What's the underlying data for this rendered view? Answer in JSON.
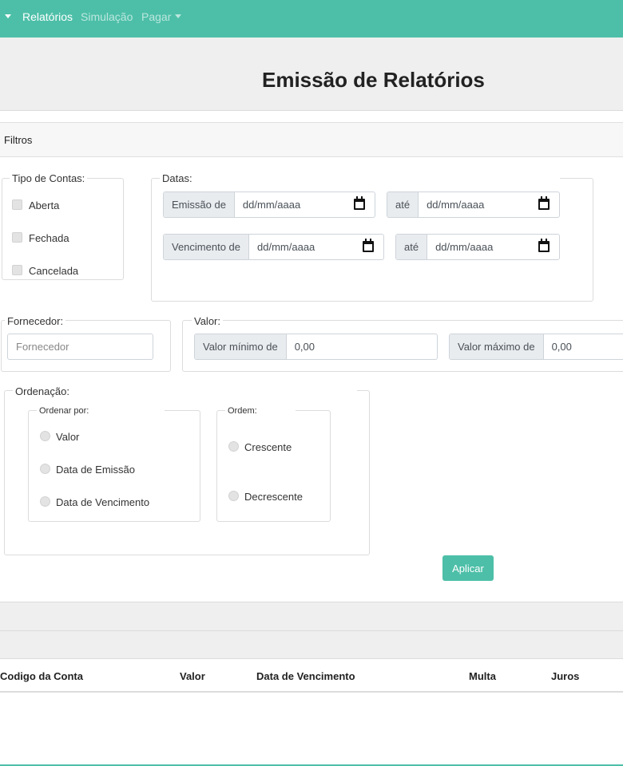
{
  "navbar": {
    "items": [
      {
        "label": "Relatórios",
        "active": true
      },
      {
        "label": "Simulação",
        "active": false
      },
      {
        "label": "Pagar",
        "active": false,
        "dropdown": true
      }
    ],
    "brand_color": "#4dbfa8"
  },
  "header": {
    "title": "Emissão de Relatórios"
  },
  "filters": {
    "title": "Filtros",
    "account_types": {
      "legend": "Tipo de Contas:",
      "options": [
        "Aberta",
        "Fechada",
        "Cancelada"
      ]
    },
    "dates": {
      "legend": "Datas:",
      "emission_label": "Emissão de",
      "due_label": "Vencimento de",
      "until_label": "até",
      "date_placeholder": "dd/mm/aaaa"
    },
    "supplier": {
      "legend": "Fornecedor:",
      "placeholder": "Fornecedor"
    },
    "value": {
      "legend": "Valor:",
      "min_label": "Valor mínimo de",
      "max_label": "Valor máximo de",
      "min_value": "0,00",
      "max_value": "0,00"
    },
    "ordering": {
      "legend": "Ordenação:",
      "order_by": {
        "legend": "Ordenar por:",
        "options": [
          "Valor",
          "Data de Emissão",
          "Data de Vencimento"
        ]
      },
      "order": {
        "legend": "Ordem:",
        "options": [
          "Crescente",
          "Decrescente"
        ]
      }
    },
    "apply_label": "Aplicar"
  },
  "table": {
    "columns": [
      "Codigo da Conta",
      "Valor",
      "Data de Vencimento",
      "Multa",
      "Juros"
    ]
  }
}
